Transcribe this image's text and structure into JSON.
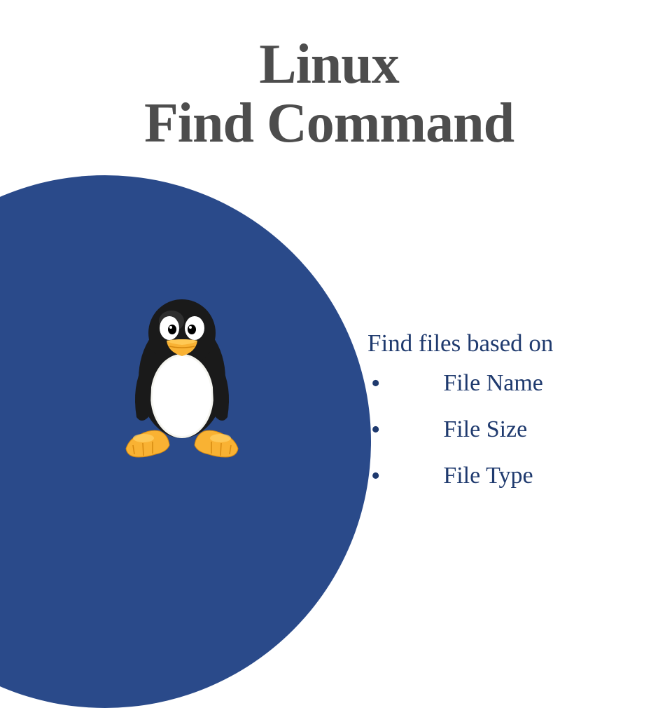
{
  "title": {
    "line1": "Linux",
    "line2": "Find Command"
  },
  "subtitle": "Find files based on",
  "list": {
    "items": [
      "File Name",
      "File Size",
      "File Type"
    ]
  },
  "colors": {
    "circle": "#2a4a8a",
    "title": "#4d4d4d",
    "text": "#1f3a6e"
  }
}
